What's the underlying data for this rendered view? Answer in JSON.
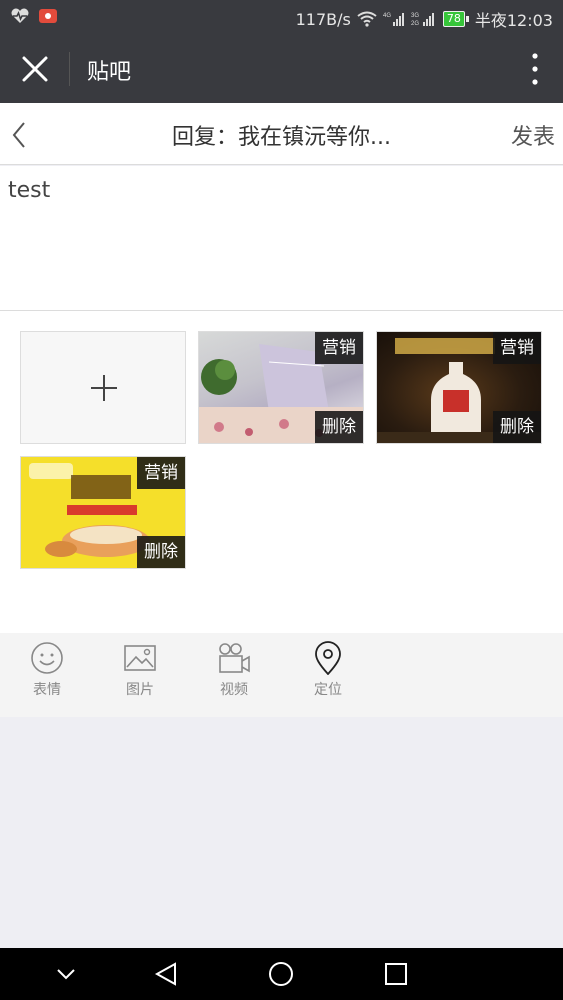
{
  "status_bar": {
    "net_speed": "117B/s",
    "battery": "78",
    "time": "半夜12:03",
    "icons": [
      "heart-rate-icon",
      "baidu-app-icon",
      "wifi-icon",
      "signal-4g-icon",
      "signal-3g-icon"
    ]
  },
  "titlebar": {
    "title": "贴吧",
    "icons": [
      "close-icon",
      "more-vertical-icon"
    ]
  },
  "navbar": {
    "title": "回复：我在镇沅等你...",
    "publish_label": "发表",
    "back_icon": "chevron-left-icon"
  },
  "editor": {
    "text": "test"
  },
  "gallery": {
    "add_icon": "plus-icon",
    "images": [
      {
        "label_top": "营销",
        "label_bottom": "删除"
      },
      {
        "label_top": "营销",
        "label_bottom": "删除"
      },
      {
        "label_top": "营销",
        "label_bottom": "删除"
      }
    ]
  },
  "toolbar": {
    "items": [
      {
        "label": "表情",
        "icon": "smiley-icon"
      },
      {
        "label": "图片",
        "icon": "image-icon"
      },
      {
        "label": "视频",
        "icon": "video-camera-icon"
      },
      {
        "label": "定位",
        "icon": "location-pin-icon"
      }
    ]
  },
  "system_nav": {
    "icons": [
      "chevron-down-icon",
      "back-triangle-icon",
      "home-circle-icon",
      "recents-square-icon"
    ]
  },
  "colors": {
    "header_bg": "#393a3f",
    "battery_green": "#37c53a"
  }
}
